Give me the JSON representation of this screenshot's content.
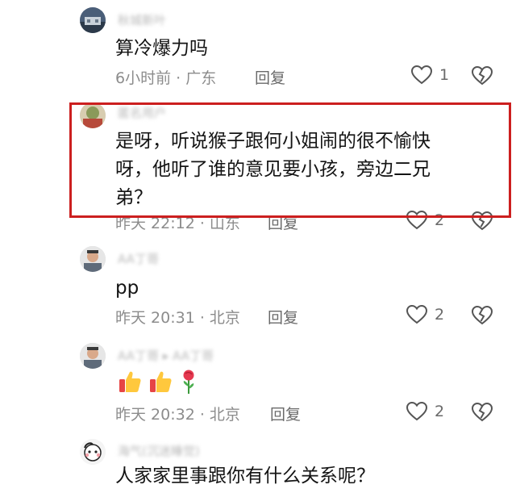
{
  "comments": [
    {
      "username": "秋城新叶",
      "text_lines": [
        "算冷爆力吗"
      ],
      "meta": "6小时前 · 广东",
      "reply_label": "回复",
      "like_count": "1"
    },
    {
      "username": "匿名用户",
      "text_lines": [
        "是呀，听说猴子跟何小姐闹的很不愉快",
        "呀，他听了谁的意见要小孩，旁边二兄",
        "弟？"
      ],
      "meta": "昨天 22:12 · 山东",
      "reply_label": "回复",
      "like_count": "2"
    },
    {
      "username": "AA丁哥",
      "text_lines": [
        "pp"
      ],
      "meta": "昨天 20:31 · 北京",
      "reply_label": "回复",
      "like_count": "2"
    },
    {
      "username": "AA丁哥 ▸ AA丁哥",
      "text_lines": [],
      "emojis": [
        "thumbs-up",
        "thumbs-up",
        "rose"
      ],
      "meta": "昨天 20:32 · 北京",
      "reply_label": "回复",
      "like_count": "2"
    },
    {
      "username": "海气(沉迷睡觉)",
      "text_lines": [
        "人家家里事跟你有什么关系呢？"
      ]
    }
  ],
  "colors": {
    "highlight_border": "#cc1f1f",
    "meta_text": "#8c8c8c",
    "icon_stroke": "#555555"
  }
}
